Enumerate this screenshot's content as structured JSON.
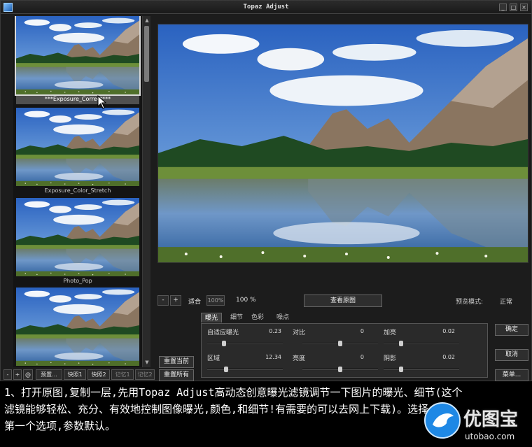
{
  "window": {
    "title": "Topaz Adjust",
    "min_glyph": "_",
    "max_glyph": "□",
    "close_glyph": "×"
  },
  "presets": [
    {
      "label": "***Exposure_Correct***",
      "selected": true
    },
    {
      "label": "Exposure_Color_Stretch",
      "selected": false
    },
    {
      "label": "Photo_Pop",
      "selected": false
    },
    {
      "label": "",
      "selected": false
    }
  ],
  "left_toolbar": {
    "minus": "-",
    "plus": "+",
    "at": "@",
    "preset_btn": "预置...",
    "snapshot1": "快照1",
    "snapshot2": "快照2",
    "memory1": "记忆1",
    "memory2": "记忆2"
  },
  "left_actions": {
    "reset_current": "重置当前",
    "reset_all": "重置所有"
  },
  "zoom": {
    "minus": "-",
    "plus": "+",
    "fit": "适合",
    "btn_100": "100%",
    "percent": "100 %",
    "view_original": "查看原图"
  },
  "preview_mode": {
    "label": "预览模式:",
    "value": "正常"
  },
  "tabs": [
    "曝光",
    "细节",
    "色彩",
    "噪点"
  ],
  "sliders": [
    {
      "label": "自适应曝光",
      "value": "0.23",
      "position": 0.22
    },
    {
      "label": "对比",
      "value": "0",
      "position": 0.5
    },
    {
      "label": "加亮",
      "value": "0.02",
      "position": 0.23
    },
    {
      "label": "区域",
      "value": "12.34",
      "position": 0.25
    },
    {
      "label": "亮度",
      "value": "0",
      "position": 0.5
    },
    {
      "label": "阴影",
      "value": "0.02",
      "position": 0.23
    }
  ],
  "side_buttons": {
    "ok": "确定",
    "cancel": "取消",
    "menu": "菜单..."
  },
  "caption": {
    "line1": "1、打开原图,复制一层,先用Topaz Adjust高动态创意曝光滤镜调节一下图片的曝光、细节(这个",
    "line2": "滤镜能够轻松、充分、有效地控制图像曝光,颜色,和细节!有需要的可以去网上下载)。选择",
    "line3": "第一个选项,参数默认。"
  },
  "watermark": {
    "name": "优图宝",
    "url": "utobao.com"
  }
}
